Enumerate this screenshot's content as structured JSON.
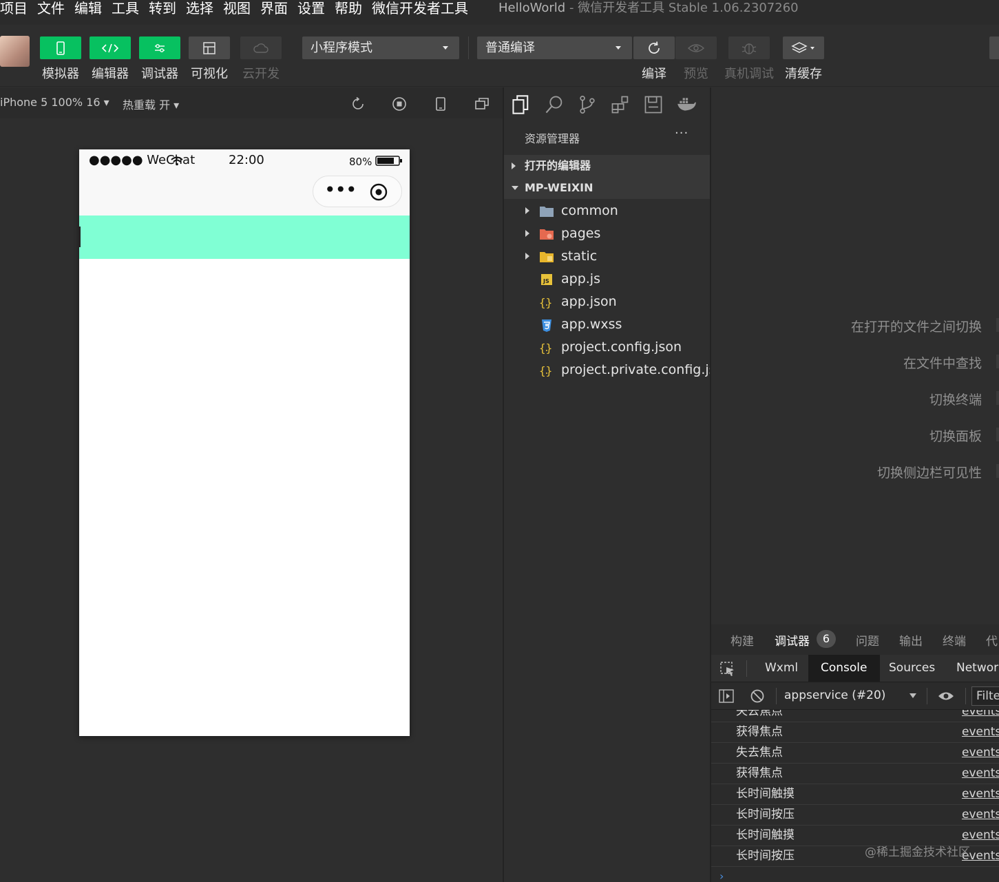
{
  "menu": [
    "项目",
    "文件",
    "编辑",
    "工具",
    "转到",
    "选择",
    "视图",
    "界面",
    "设置",
    "帮助",
    "微信开发者工具"
  ],
  "window_title": {
    "project": "HelloWorld",
    "separator": " - ",
    "app": "微信开发者工具 Stable 1.06.2307260"
  },
  "toolbar": {
    "buttons": [
      {
        "label": "模拟器",
        "icon": "phone-icon",
        "style": "green"
      },
      {
        "label": "编辑器",
        "icon": "code-icon",
        "style": "green"
      },
      {
        "label": "调试器",
        "icon": "debug-sliders-icon",
        "style": "green"
      },
      {
        "label": "可视化",
        "icon": "layout-icon",
        "style": "gray"
      },
      {
        "label": "云开发",
        "icon": "cloud-icon",
        "style": "disabled"
      }
    ],
    "mode_select": "小程序模式",
    "compile_select": "普通编译",
    "actions": [
      {
        "label": "编译",
        "icon": "refresh-icon",
        "enabled": true
      },
      {
        "label": "预览",
        "icon": "eye-icon",
        "enabled": false
      },
      {
        "label": "真机调试",
        "icon": "bug-icon",
        "enabled": false
      },
      {
        "label": "清缓存",
        "icon": "layers-icon",
        "enabled": true
      }
    ]
  },
  "simulator": {
    "device": "iPhone 5 100% 16",
    "hot_reload": "热重载 开",
    "status": {
      "carrier": "●●●●● WeChat",
      "time": "22:00",
      "battery": "80%"
    },
    "capsule": {
      "menu": "•••"
    },
    "bar_color": "#80ffd4"
  },
  "explorer": {
    "title": "资源管理器",
    "more": "···",
    "open_editors": "打开的编辑器",
    "project": "MP-WEIXIN",
    "files": [
      {
        "name": "common",
        "icon": "folder-icon",
        "expandable": true
      },
      {
        "name": "pages",
        "icon": "folder-pages-icon",
        "expandable": true
      },
      {
        "name": "static",
        "icon": "folder-static-icon",
        "expandable": true
      },
      {
        "name": "app.js",
        "icon": "js-file-icon",
        "expandable": false
      },
      {
        "name": "app.json",
        "icon": "json-file-icon",
        "expandable": false
      },
      {
        "name": "app.wxss",
        "icon": "css-file-icon",
        "expandable": false
      },
      {
        "name": "project.config.json",
        "icon": "json-file-icon",
        "expandable": false
      },
      {
        "name": "project.private.config.js...",
        "icon": "json-file-icon",
        "expandable": false
      }
    ]
  },
  "shortcuts": [
    "在打开的文件之间切换",
    "在文件中查找",
    "切换终端",
    "切换面板",
    "切换侧边栏可见性"
  ],
  "debug": {
    "tabs": [
      "构建",
      "调试器",
      "问题",
      "输出",
      "终端",
      "代"
    ],
    "badge": "6",
    "dev_tabs": [
      "Wxml",
      "Console",
      "Sources",
      "Network"
    ],
    "context": "appservice (#20)",
    "filter": "Filter",
    "logs": [
      {
        "msg": "失去焦点",
        "src": "events"
      },
      {
        "msg": "获得焦点",
        "src": "events"
      },
      {
        "msg": "失去焦点",
        "src": "events"
      },
      {
        "msg": "获得焦点",
        "src": "events"
      },
      {
        "msg": "长时间触摸",
        "src": "events"
      },
      {
        "msg": "长时间按压",
        "src": "events"
      },
      {
        "msg": "长时间触摸",
        "src": "events"
      },
      {
        "msg": "长时间按压",
        "src": "events"
      }
    ],
    "prompt": "›",
    "watermark": "@稀土掘金技术社区"
  }
}
